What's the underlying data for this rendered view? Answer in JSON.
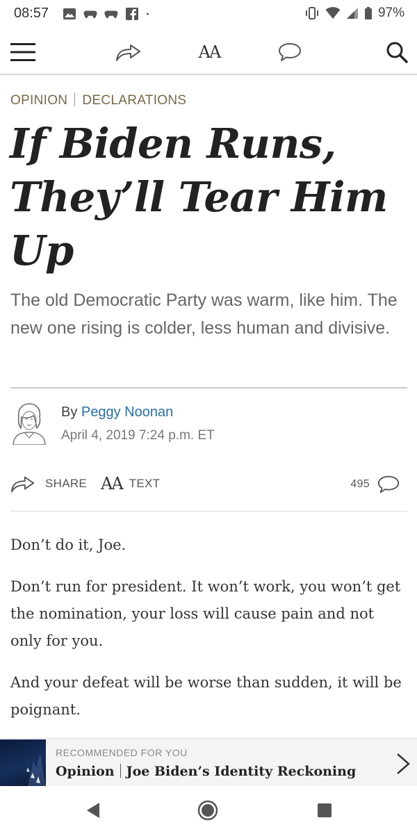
{
  "status_bar": {
    "time": "08:57",
    "battery": "97%",
    "left_icons": [
      "image-icon",
      "game-controller-icon",
      "game-controller-icon",
      "facebook-icon",
      "dot-icon"
    ],
    "right_icons": [
      "vibrate-icon",
      "wifi-icon",
      "signal-icon",
      "battery-icon"
    ]
  },
  "toolbar": {
    "menu_icon": "hamburger-icon",
    "share_icon": "share-arrow-icon",
    "text_size_label": "AA",
    "comment_icon": "comment-icon",
    "search_icon": "search-icon"
  },
  "article": {
    "section": "OPINION",
    "column": "DECLARATIONS",
    "headline_lines": [
      "If Biden Runs,",
      "They’ll Tear Him",
      "Up"
    ],
    "dek": "The old Democratic Party was warm, like him. The new one rising is colder, less human and divisive.",
    "byline_prefix": "By",
    "author": "Peggy Noonan",
    "date": "April 4, 2019 7:24 p.m. ET",
    "share_label": "SHARE",
    "text_label": "TEXT",
    "text_icon_label": "AA",
    "comment_count": "495",
    "paragraphs": [
      "Don’t do it, Joe.",
      "Don’t run for president. It won’t work, you won’t get the nomination, your loss will cause pain and not only for you.",
      "And your defeat will be worse than sudden, it will be poignant."
    ]
  },
  "recommended": {
    "kicker": "RECOMMENDED FOR YOU",
    "section": "Opinion",
    "title": "Joe Biden’s Identity Reckoning"
  },
  "nav_bar": {
    "back_icon": "back-triangle-icon",
    "home_icon": "home-circle-icon",
    "recents_icon": "recents-square-icon"
  },
  "colors": {
    "section_label": "#7a6746",
    "author_link": "#2a6fa8",
    "headline": "#222222",
    "dek": "#666666"
  }
}
